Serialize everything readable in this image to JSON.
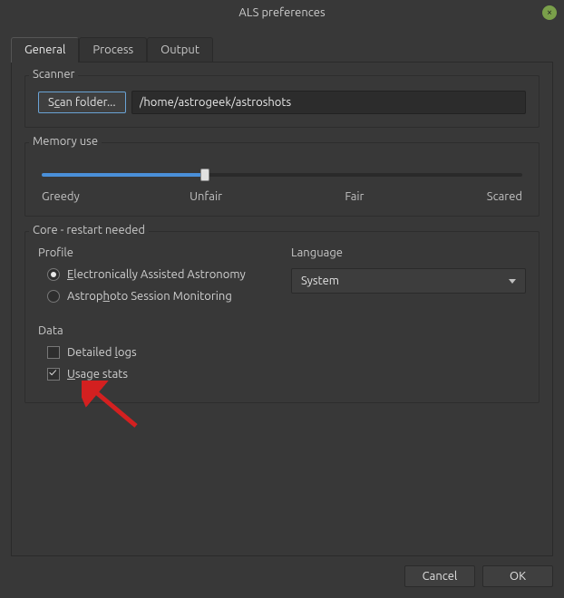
{
  "window": {
    "title": "ALS preferences"
  },
  "tabs": {
    "general": "General",
    "process": "Process",
    "output": "Output",
    "active": "general"
  },
  "scanner": {
    "legend": "Scanner",
    "scan_button_pre": "S",
    "scan_button_mnemonic": "c",
    "scan_button_post": "an folder...",
    "path_value": "/home/astrogeek/astroshots"
  },
  "memory": {
    "legend": "Memory use",
    "labels": {
      "l0": "Greedy",
      "l1": "Unfair",
      "l2": "Fair",
      "l3": "Scared"
    },
    "value_percent": 34
  },
  "core": {
    "legend": "Core - restart needed",
    "profile": {
      "heading": "Profile",
      "opt1_pre": "",
      "opt1_mnemonic": "E",
      "opt1_post": "lectronically Assisted Astronomy",
      "opt2_pre": "Astrop",
      "opt2_mnemonic": "h",
      "opt2_post": "oto Session Monitoring",
      "selected": "opt1"
    },
    "language": {
      "heading": "Language",
      "selected": "System"
    }
  },
  "data": {
    "legend": "Data",
    "detailed_pre": "Detailed ",
    "detailed_mnemonic": "l",
    "detailed_post": "ogs",
    "detailed_checked": false,
    "usage_pre": "",
    "usage_mnemonic": "U",
    "usage_post": "sage stats",
    "usage_checked": true
  },
  "footer": {
    "cancel": "Cancel",
    "ok": "OK"
  }
}
